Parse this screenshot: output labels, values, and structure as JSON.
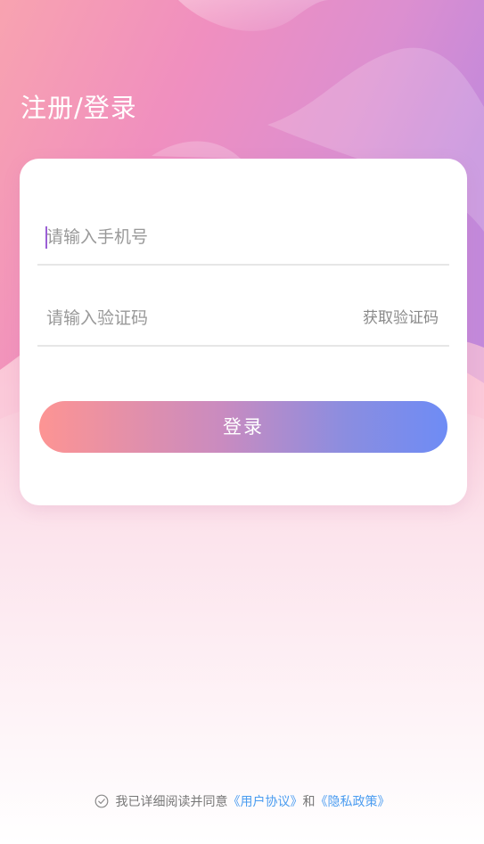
{
  "header": {
    "title": "注册/登录"
  },
  "form": {
    "phone_placeholder": "请输入手机号",
    "phone_value": "",
    "code_placeholder": "请输入验证码",
    "code_value": "",
    "get_code_label": "获取验证码",
    "login_label": "登录"
  },
  "agreement": {
    "check_icon": "check-circle-icon",
    "text_before": "我已详细阅读并同意",
    "user_agreement_link": "《用户协议》",
    "conjunction": "和",
    "privacy_policy_link": "《隐私政策》"
  },
  "colors": {
    "header_gradient": [
      "#f7a1b2",
      "#e98ec2",
      "#c68ad9"
    ],
    "button_gradient_start": "#fd9493",
    "button_gradient_end": "#6e8cf5",
    "link": "#4a9cf0",
    "caret": "#9b5fd6"
  }
}
